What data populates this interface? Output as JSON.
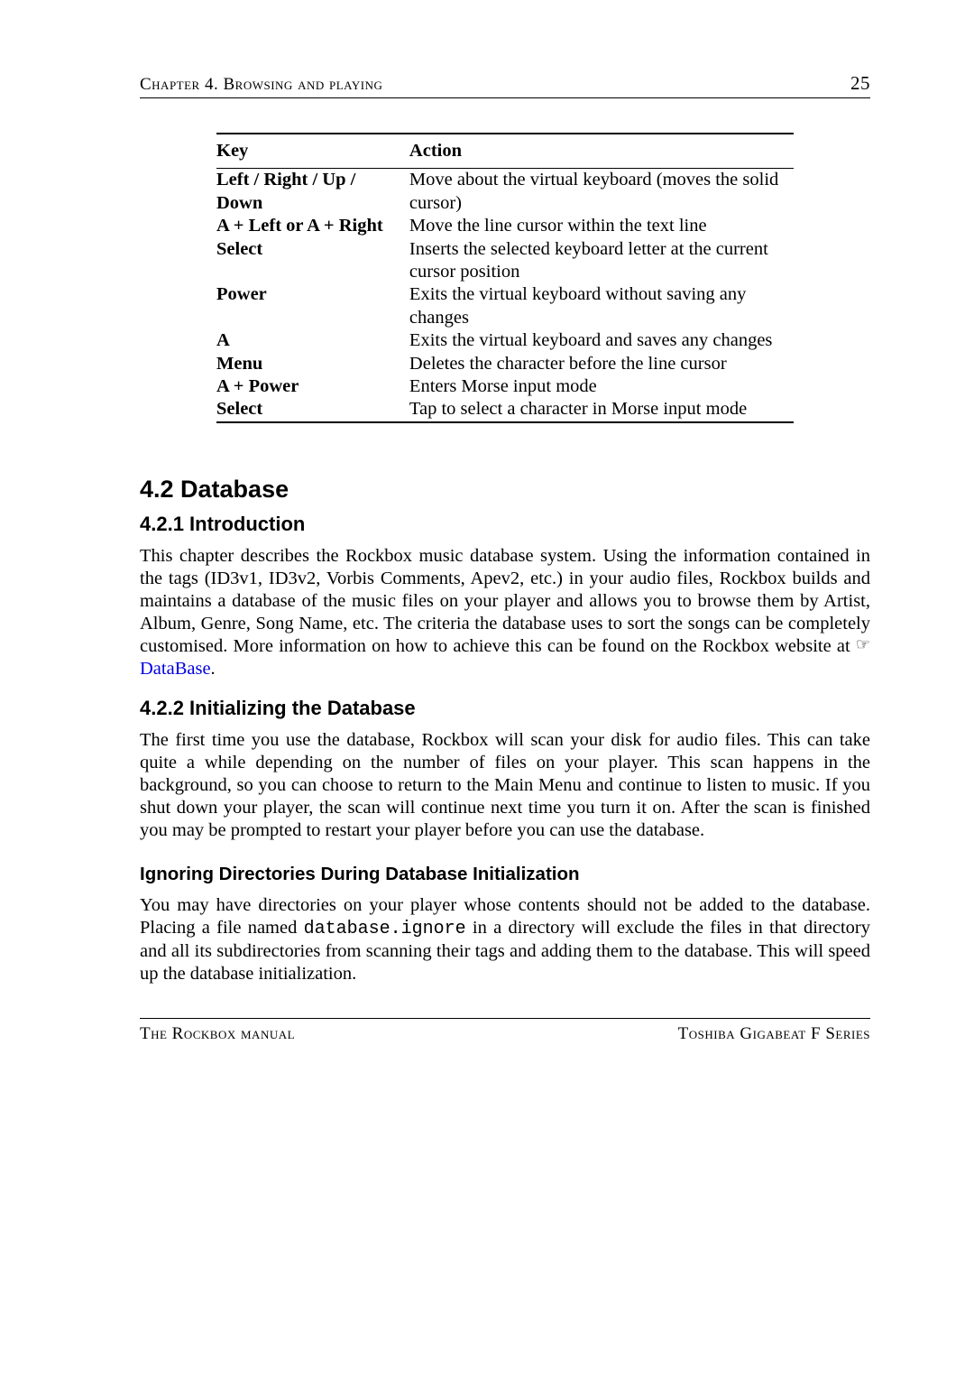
{
  "header": {
    "chapter": "Chapter 4.  Browsing and playing",
    "page": "25"
  },
  "table": {
    "head": {
      "key": "Key",
      "action": "Action"
    },
    "rows": [
      {
        "key": "Left / Right / Up / Down",
        "action": "Move about the virtual keyboard (moves the solid cursor)"
      },
      {
        "key": "A + Left or A + Right",
        "action": "Move the line cursor within the text line"
      },
      {
        "key": "Select",
        "action": "Inserts the selected keyboard letter at the current cursor position"
      },
      {
        "key": "Power",
        "action": "Exits the virtual keyboard without saving any changes"
      },
      {
        "key": "A",
        "action": "Exits the virtual keyboard and saves any changes"
      },
      {
        "key": "Menu",
        "action": "Deletes the character before the line cursor"
      },
      {
        "key": "A + Power",
        "action": "Enters Morse input mode"
      },
      {
        "key": "Select",
        "action": "Tap to select a character in Morse input mode"
      }
    ]
  },
  "s1": {
    "title": "4.2 Database",
    "s11": {
      "title": "4.2.1 Introduction",
      "p_a": "This chapter describes the Rockbox music database system.  Using the information contained in the tags (ID3v1, ID3v2, Vorbis Comments, Apev2, etc.)  in your audio files, Rockbox builds and maintains a database of the music files on your player and allows you to browse them by Artist, Album, Genre, Song Name, etc. The criteria the database uses to sort the songs can be completely customised. More information on how to achieve this can be found on the Rockbox website at ",
      "link": "DataBase",
      "p_b": "."
    },
    "s12": {
      "title": "4.2.2 Initializing the Database",
      "p": "The first time you use the database, Rockbox will scan your disk for audio files. This can take quite a while depending on the number of files on your player. This scan happens in the background, so you can choose to return to the Main Menu and continue to listen to music. If you shut down your player, the scan will continue next time you turn it on. After the scan is finished you may be prompted to restart your player before you can use the database.",
      "sub": {
        "title": "Ignoring Directories During Database Initialization",
        "p_a": "You may have directories on your player whose contents should not be added to the database. Placing a file named ",
        "code": "database.ignore",
        "p_b": " in a directory will exclude the files in that directory and all its subdirectories from scanning their tags and adding them to the database. This will speed up the database initialization."
      }
    }
  },
  "footer": {
    "left": "The Rockbox manual",
    "right": "Toshiba Gigabeat F Series"
  }
}
